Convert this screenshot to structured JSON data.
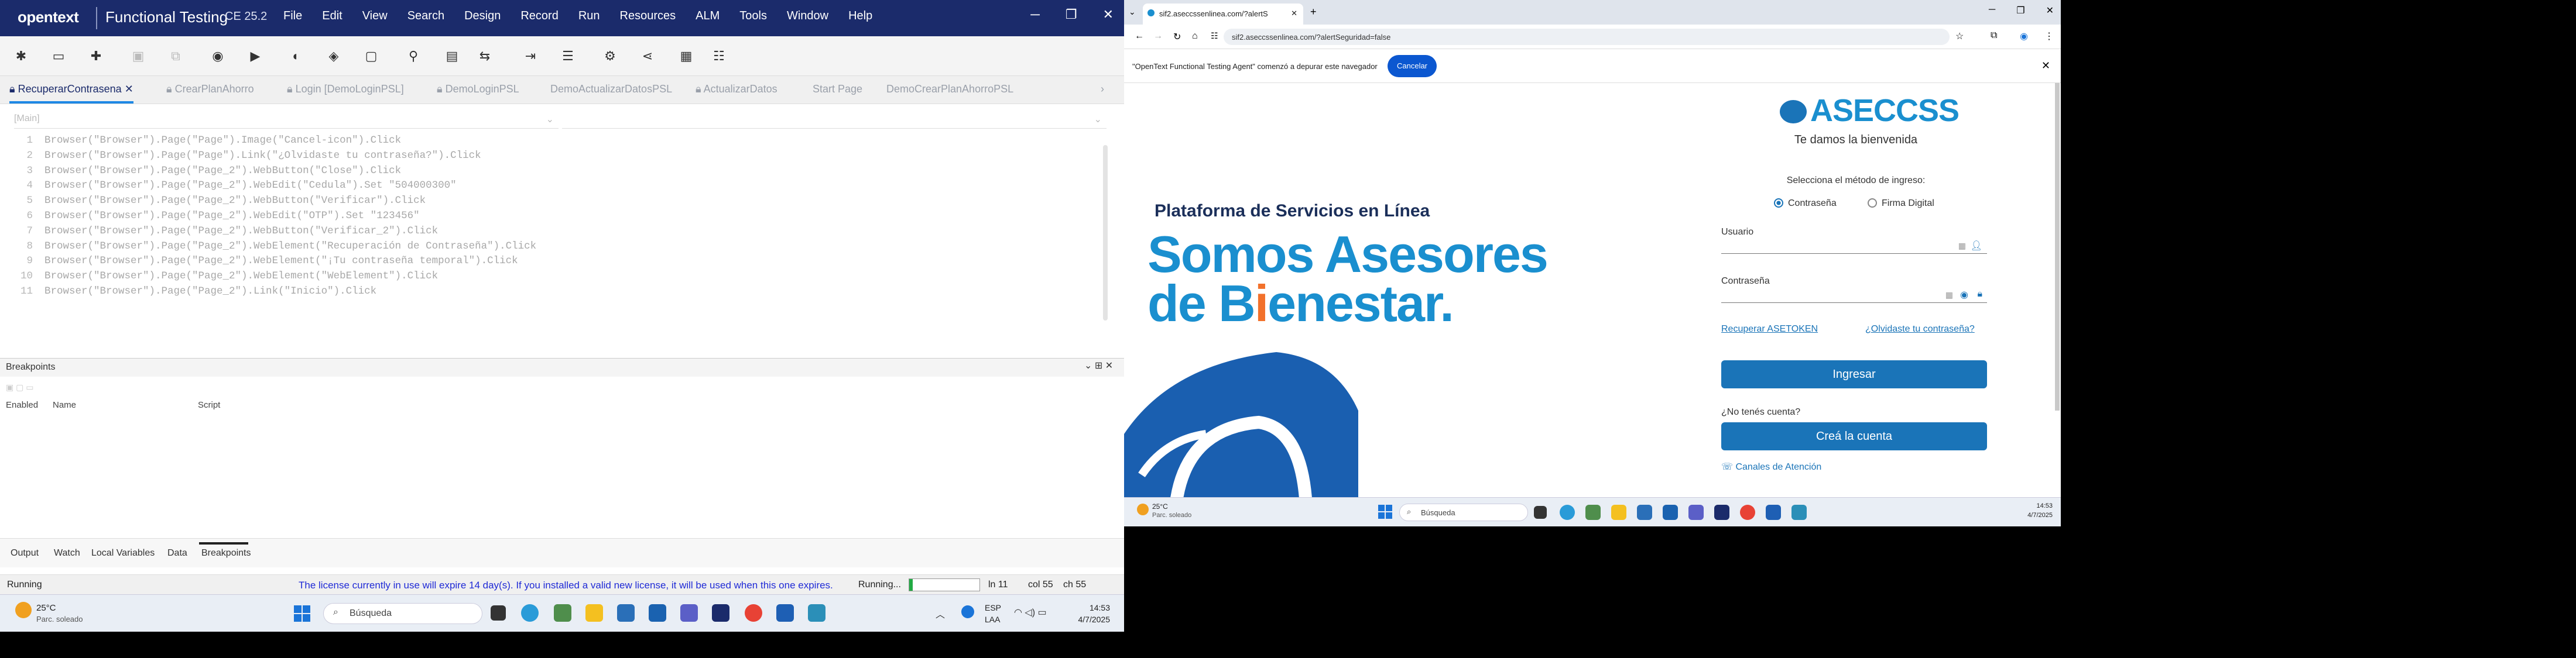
{
  "uft": {
    "brand": "opentext",
    "app_title": "Functional Testing",
    "version": "CE 25.2",
    "menu": [
      "File",
      "Edit",
      "View",
      "Search",
      "Design",
      "Record",
      "Run",
      "Resources",
      "ALM",
      "Tools",
      "Window",
      "Help"
    ],
    "tabs": [
      "RecuperarContrasena",
      "CrearPlanAhorro",
      "Login [DemoLoginPSL]",
      "DemoLoginPSL",
      "DemoActualizarDatosPSL",
      "ActualizarDatos",
      "Start Page",
      "DemoCrearPlanAhorroPSL"
    ],
    "active_tab": "RecuperarContrasena",
    "editor_dropdown": "[Main]",
    "code_lines": [
      {
        "n": "1",
        "text": "Browser(\"Browser\").Page(\"Page\").Image(\"Cancel-icon\").Click"
      },
      {
        "n": "2",
        "text": "Browser(\"Browser\").Page(\"Page\").Link(\"¿Olvidaste tu contraseña?\").Click"
      },
      {
        "n": "3",
        "text": "Browser(\"Browser\").Page(\"Page_2\").WebButton(\"Close\").Click"
      },
      {
        "n": "4",
        "text": "Browser(\"Browser\").Page(\"Page_2\").WebEdit(\"Cedula\").Set \"504000300\""
      },
      {
        "n": "5",
        "text": "Browser(\"Browser\").Page(\"Page_2\").WebButton(\"Verificar\").Click"
      },
      {
        "n": "6",
        "text": "Browser(\"Browser\").Page(\"Page_2\").WebEdit(\"OTP\").Set \"123456\""
      },
      {
        "n": "7",
        "text": "Browser(\"Browser\").Page(\"Page_2\").WebButton(\"Verificar_2\").Click"
      },
      {
        "n": "8",
        "text": "Browser(\"Browser\").Page(\"Page_2\").WebElement(\"Recuperación de Contraseña\").Click"
      },
      {
        "n": "9",
        "text": "Browser(\"Browser\").Page(\"Page_2\").WebElement(\"¡Tu contraseña temporal\").Click"
      },
      {
        "n": "10",
        "text": "Browser(\"Browser\").Page(\"Page_2\").WebElement(\"WebElement\").Click"
      },
      {
        "n": "11",
        "text": "Browser(\"Browser\").Page(\"Page_2\").Link(\"Inicio\").Click"
      }
    ],
    "breakpoints_title": "Breakpoints",
    "bp_columns": [
      "Enabled",
      "Name",
      "Script"
    ],
    "bottom_tabs": [
      "Output",
      "Watch",
      "Local Variables",
      "Data",
      "Breakpoints"
    ],
    "active_bottom_tab": "Breakpoints",
    "status": {
      "state": "Running",
      "license": "The license currently in use will expire 14 day(s). If you installed a valid new license, it will be used when this one expires.",
      "state2": "Running...",
      "progress": 0.05,
      "ln": "ln 11",
      "col": "col 55",
      "ch": "ch 55"
    }
  },
  "taskbar_left": {
    "temp": "25°C",
    "weather": "Parc. soleado",
    "search_placeholder": "Búsqueda",
    "lang1": "ESP",
    "lang2": "LAA",
    "time": "14:53",
    "date": "4/7/2025"
  },
  "browser": {
    "tab_title": "sif2.aseccssenlinea.com/?alertS",
    "url": "sif2.aseccssenlinea.com/?alertSeguridad=false",
    "notice": "\"OpenText Functional Testing Agent\" comenzó a depurar este navegador",
    "cancel": "Cancelar",
    "page": {
      "platform": "Plataforma de Servicios en Línea",
      "hero_line1": "Somos Asesores",
      "hero_line2_a": "de B",
      "hero_line2_b": "i",
      "hero_line2_c": "enestar.",
      "logo": "ASECCSS",
      "welcome": "Te damos la bienvenida",
      "method_label": "Selecciona el método de ingreso:",
      "radio_password": "Contraseña",
      "radio_signature": "Firma Digital",
      "user_label": "Usuario",
      "password_label": "Contraseña",
      "recover_token": "Recuperar ASETOKEN",
      "forgot": "¿Olvidaste tu contraseña?",
      "login_btn": "Ingresar",
      "no_account": "¿No tenés cuenta?",
      "create_btn": "Creá la cuenta",
      "channels": "Canales de Atención"
    }
  },
  "taskbar_right": {
    "temp": "25°C",
    "weather": "Parc. soleado",
    "search_placeholder": "Búsqueda",
    "time": "14:53",
    "date": "4/7/2025"
  }
}
